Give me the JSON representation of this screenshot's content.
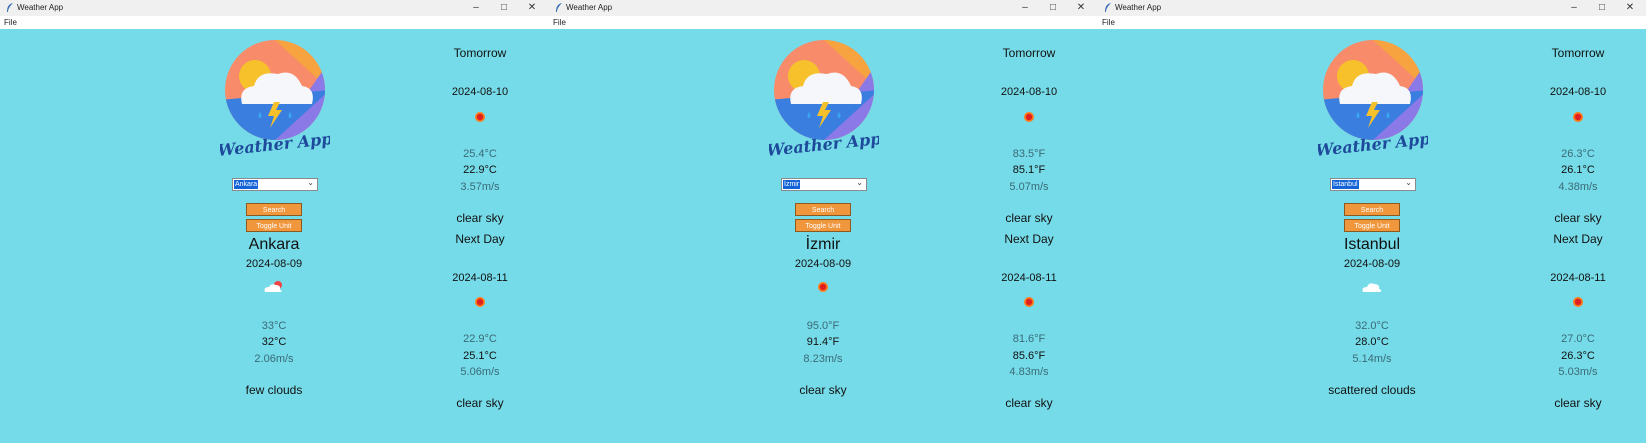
{
  "app_title": "Weather App",
  "menu_file": "File",
  "logo_text": "Weather App",
  "search_label": "Search",
  "toggle_label": "Toggle Unit",
  "tomorrow_label": "Tomorrow",
  "next_day_label": "Next Day",
  "windows": [
    {
      "city_select": "Ankara",
      "city": "Ankara",
      "date": "2024-08-09",
      "icon": "few-clouds-icon",
      "temp": "33°C",
      "feels": "32°C",
      "wind": "2.06m/s",
      "desc": "few clouds",
      "day1": {
        "date": "2024-08-10",
        "icon": "sun-icon",
        "temp1": "25.4°C",
        "temp2": "22.9°C",
        "wind": "3.57m/s",
        "desc": "clear sky"
      },
      "day2": {
        "date": "2024-08-11",
        "icon": "sun-icon",
        "temp1": "22.9°C",
        "temp2": "25.1°C",
        "wind": "5.06m/s",
        "desc": "clear sky"
      }
    },
    {
      "city_select": "İzmir",
      "city": "İzmir",
      "date": "2024-08-09",
      "icon": "sun-icon",
      "temp": "95.0°F",
      "feels": "91.4°F",
      "wind": "8.23m/s",
      "desc": "clear sky",
      "day1": {
        "date": "2024-08-10",
        "icon": "sun-icon",
        "temp1": "83.5°F",
        "temp2": "85.1°F",
        "wind": "5.07m/s",
        "desc": "clear sky"
      },
      "day2": {
        "date": "2024-08-11",
        "icon": "sun-icon",
        "temp1": "81.6°F",
        "temp2": "85.6°F",
        "wind": "4.83m/s",
        "desc": "clear sky"
      }
    },
    {
      "city_select": "Istanbul",
      "city": "Istanbul",
      "date": "2024-08-09",
      "icon": "cloud-icon",
      "temp": "32.0°C",
      "feels": "28.0°C",
      "wind": "5.14m/s",
      "desc": "scattered clouds",
      "day1": {
        "date": "2024-08-10",
        "icon": "sun-icon",
        "temp1": "26.3°C",
        "temp2": "26.1°C",
        "wind": "4.38m/s",
        "desc": "clear sky"
      },
      "day2": {
        "date": "2024-08-11",
        "icon": "sun-icon",
        "temp1": "27.0°C",
        "temp2": "26.3°C",
        "wind": "5.03m/s",
        "desc": "clear sky"
      }
    }
  ],
  "colors": {
    "background": "#76dbe8",
    "button": "#f0963c",
    "selection": "#1464d8"
  }
}
